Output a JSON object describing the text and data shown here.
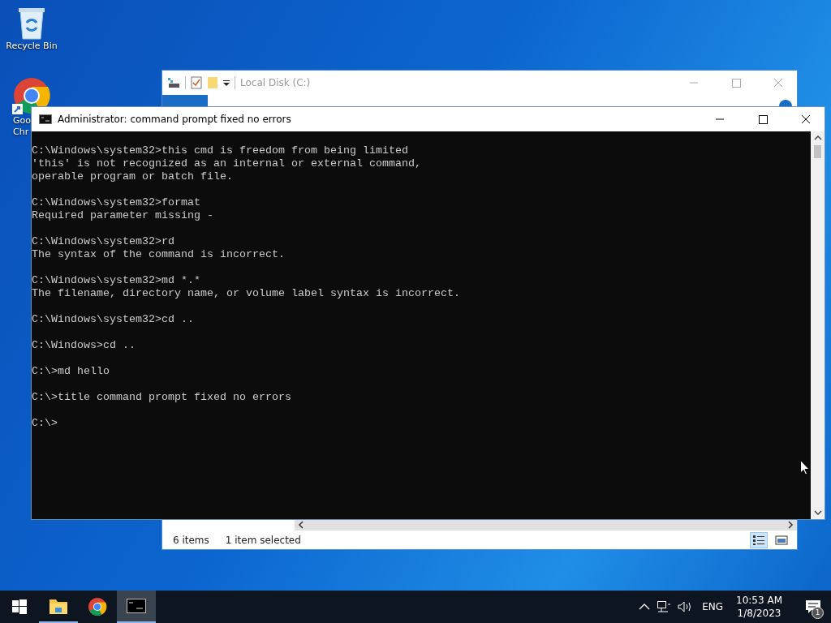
{
  "desktop_icons": [
    {
      "kind": "recycle-bin",
      "label_lines": [
        "Recycle Bin"
      ]
    },
    {
      "kind": "chrome",
      "label_lines": [
        "Goo",
        "Chr"
      ]
    }
  ],
  "explorer": {
    "title": "Local Disk (C:)",
    "ribbon_tabs": [
      {
        "selected": true
      }
    ],
    "status": [
      "6 items",
      "1 item selected"
    ],
    "view_buttons": [
      {
        "kind": "details",
        "selected": true
      },
      {
        "kind": "large-icons",
        "selected": false
      }
    ]
  },
  "cmd": {
    "title": "Administrator:  command prompt fixed no errors",
    "blocks": [
      [
        "C:\\Windows\\system32>this cmd is freedom from being limited",
        "'this' is not recognized as an internal or external command,",
        "operable program or batch file."
      ],
      [
        "C:\\Windows\\system32>format",
        "Required parameter missing -"
      ],
      [
        "C:\\Windows\\system32>rd",
        "The syntax of the command is incorrect."
      ],
      [
        "C:\\Windows\\system32>md *.*",
        "The filename, directory name, or volume label syntax is incorrect."
      ],
      [
        "C:\\Windows\\system32>cd .."
      ],
      [
        "C:\\Windows>cd .."
      ],
      [
        "C:\\>md hello"
      ],
      [
        "C:\\>title command prompt fixed no errors"
      ],
      [
        "C:\\>"
      ]
    ]
  },
  "taskbar": {
    "apps": [
      {
        "kind": "explorer",
        "running": true,
        "active": false
      },
      {
        "kind": "chrome",
        "running": false,
        "active": false
      },
      {
        "kind": "cmd",
        "running": true,
        "active": true
      }
    ],
    "language": "ENG",
    "time": "10:53 AM",
    "date": "1/8/2023",
    "notifications": "1"
  }
}
